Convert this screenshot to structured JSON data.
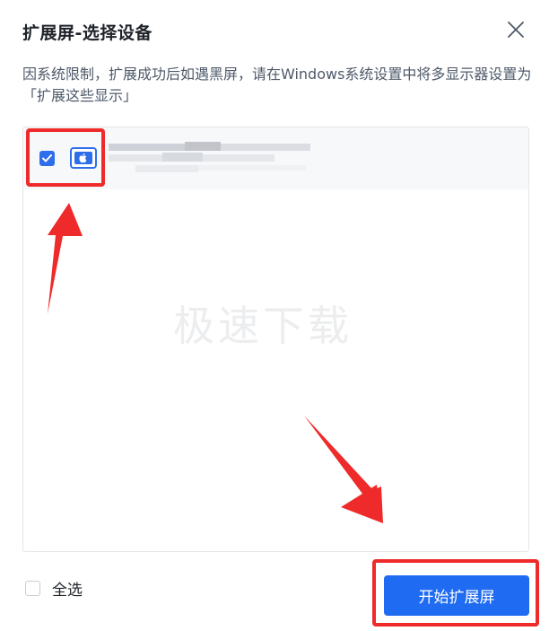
{
  "dialog": {
    "title": "扩展屏-选择设备",
    "notice": "因系统限制，扩展成功后如遇黑屏，请在Windows系统设置中将多显示器设置为「扩展这些显示」"
  },
  "device_list": {
    "devices": [
      {
        "checked": true,
        "os_icon": "apple-icon",
        "name_redacted": true
      }
    ],
    "watermark": "极速下载"
  },
  "footer": {
    "select_all_label": "全选",
    "select_all_checked": false,
    "start_button_label": "开始扩展屏"
  },
  "colors": {
    "accent": "#1f6bf2",
    "annotation_red": "#ee2a2a",
    "row_selected_bg": "#f7f8fa"
  }
}
